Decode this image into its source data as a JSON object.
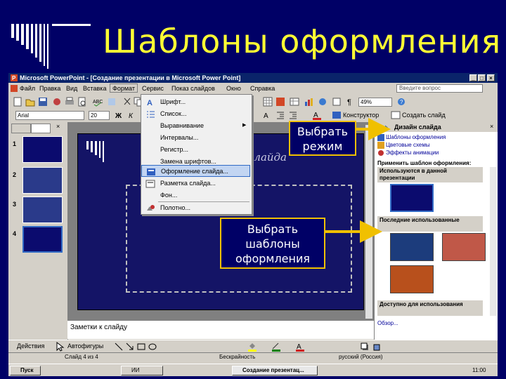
{
  "slide": {
    "title": "Шаблоны оформления",
    "accent": "#ffff33",
    "background": "#000066"
  },
  "window": {
    "title": "Microsoft PowerPoint - [Создание презентации в Microsoft Power Point]",
    "buttons": [
      "minimize-icon",
      "maximize-icon",
      "close-icon"
    ]
  },
  "menubar": {
    "items": [
      "Файл",
      "Правка",
      "Вид",
      "Вставка",
      "Формат",
      "Сервис",
      "Показ слайдов",
      "Окно",
      "Справка"
    ],
    "active": "Формат",
    "ask_placeholder": "Введите вопрос"
  },
  "toolbar": {
    "zoom": "49%",
    "font": "Arial",
    "size": "20",
    "constructor_label": "Конструктор",
    "new_slide_label": "Создать слайд"
  },
  "format_menu": {
    "items": [
      {
        "label": "Шрифт...",
        "icon": "font-icon"
      },
      {
        "label": "Список...",
        "icon": "list-icon"
      },
      {
        "label": "Выравнивание",
        "icon": "",
        "submenu": true
      },
      {
        "label": "Интервалы...",
        "icon": ""
      },
      {
        "label": "Регистр...",
        "icon": ""
      },
      {
        "label": "Замена шрифтов...",
        "icon": ""
      },
      {
        "label": "Оформление слайда...",
        "icon": "slide-design-icon",
        "selected": true
      },
      {
        "label": "Разметка слайда...",
        "icon": "slide-layout-icon"
      },
      {
        "label": "Фон...",
        "icon": ""
      },
      {
        "label": "Полотно...",
        "icon": "canvas-icon"
      }
    ]
  },
  "slides_pane": {
    "numbers": [
      "1",
      "2",
      "3",
      "4"
    ]
  },
  "slide_canvas": {
    "subtitle_fragment": "слайда"
  },
  "notes": {
    "placeholder": "Заметки к слайду"
  },
  "task_pane": {
    "title": "Дизайн слайда",
    "links": [
      "Шаблоны оформления",
      "Цветовые схемы",
      "Эффекты анимации"
    ],
    "apply_label": "Применить шаблон оформления:",
    "section_current": "Используются в данной презентации",
    "section_recent": "Последние использованные",
    "section_available": "Доступно для использования",
    "browse": "Обзор..."
  },
  "drawing_toolbar": {
    "actions": "Действия",
    "autoshapes": "Автофигуры"
  },
  "status_bar": {
    "slide": "Слайд 4 из 4",
    "design": "Бескрайность",
    "language": "русский (Россия)"
  },
  "taskbar": {
    "start": "Пуск",
    "button1": "ИИ",
    "button2": "Создание презентац...",
    "tray_time": "11:00"
  },
  "callouts": {
    "mode": "Выбрать режим",
    "templates": "Выбрать шаблоны оформления"
  }
}
